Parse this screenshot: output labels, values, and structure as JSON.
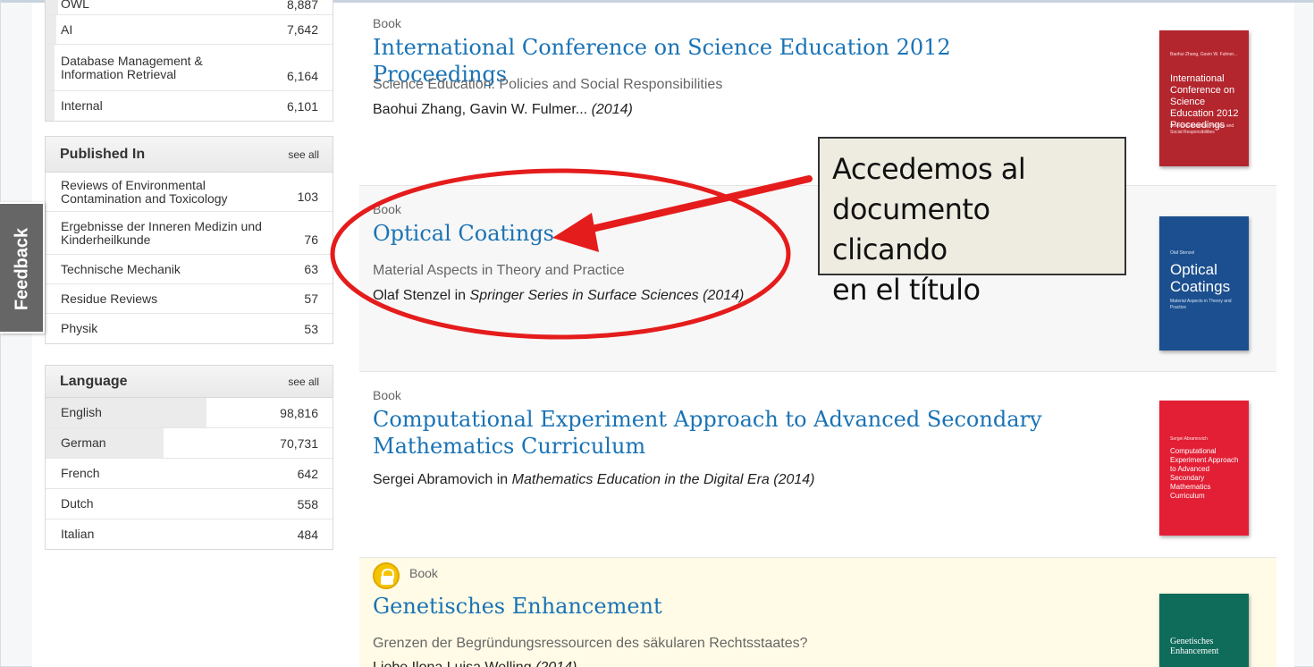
{
  "facets": {
    "subject_partial_rows": [
      {
        "label": "OWL",
        "count": "8,887"
      },
      {
        "label": "AI",
        "count": "7,642"
      },
      {
        "label": "Database Management & Information Retrieval",
        "count": "6,164"
      },
      {
        "label": "Internal",
        "count": "6,101"
      }
    ],
    "published_in": {
      "title": "Published In",
      "see_all": "see all",
      "rows": [
        {
          "label": "Reviews of Environmental Contamination and Toxicology",
          "count": "103"
        },
        {
          "label": "Ergebnisse der Inneren Medizin und Kinderheilkunde",
          "count": "76"
        },
        {
          "label": "Technische Mechanik",
          "count": "63"
        },
        {
          "label": "Residue Reviews",
          "count": "57"
        },
        {
          "label": "Physik",
          "count": "53"
        }
      ]
    },
    "language": {
      "title": "Language",
      "see_all": "see all",
      "rows": [
        {
          "label": "English",
          "count": "98,816",
          "fill_fraction": 0.56
        },
        {
          "label": "German",
          "count": "70,731",
          "fill_fraction": 0.41
        },
        {
          "label": "French",
          "count": "642",
          "fill_fraction": 0
        },
        {
          "label": "Dutch",
          "count": "558",
          "fill_fraction": 0
        },
        {
          "label": "Italian",
          "count": "484",
          "fill_fraction": 0
        }
      ]
    }
  },
  "feedback": {
    "label": "Feedback"
  },
  "results": [
    {
      "type": "Book",
      "title": "International Conference on Science Education 2012 Proceedings",
      "subtitle": "Science Education: Policies and Social Responsibilities",
      "authors": "Baohui Zhang, Gavin W. Fulmer...",
      "year": "(2014)",
      "cover": {
        "title": "International Conference on Science Education 2012 Proceedings",
        "color": "#b3262e"
      }
    },
    {
      "type": "Book",
      "title": "Optical Coatings",
      "subtitle": "Material Aspects in Theory and Practice",
      "authors": "Olaf Stenzel",
      "in_word": "in",
      "series": "Springer Series in Surface Sciences (2014)",
      "cover": {
        "title": "Optical Coatings",
        "color": "#1b4f8f"
      }
    },
    {
      "type": "Book",
      "title": "Computational Experiment Approach to Advanced Secondary Mathematics Curriculum",
      "authors": "Sergei Abramovich",
      "in_word": "in",
      "series": "Mathematics Education in the Digital Era (2014)",
      "cover": {
        "title": "Computational Experiment Approach to Advanced Secondary Mathematics Curriculum",
        "color": "#e21f35"
      }
    },
    {
      "type": "Book",
      "title": "Genetisches Enhancement",
      "subtitle": "Grenzen der Begründungsressourcen des säkularen Rechtsstaates?",
      "authors": "Liebe Ilona Luisa Welling",
      "year": "(2014)",
      "cover": {
        "title": "Genetisches Enhancement",
        "color": "#0f6b5a"
      }
    }
  ],
  "annotation": {
    "text_line1": "Accedemos al",
    "text_line2": "documento clicando",
    "text_line3": "en el título",
    "color": "#e51c1c"
  }
}
